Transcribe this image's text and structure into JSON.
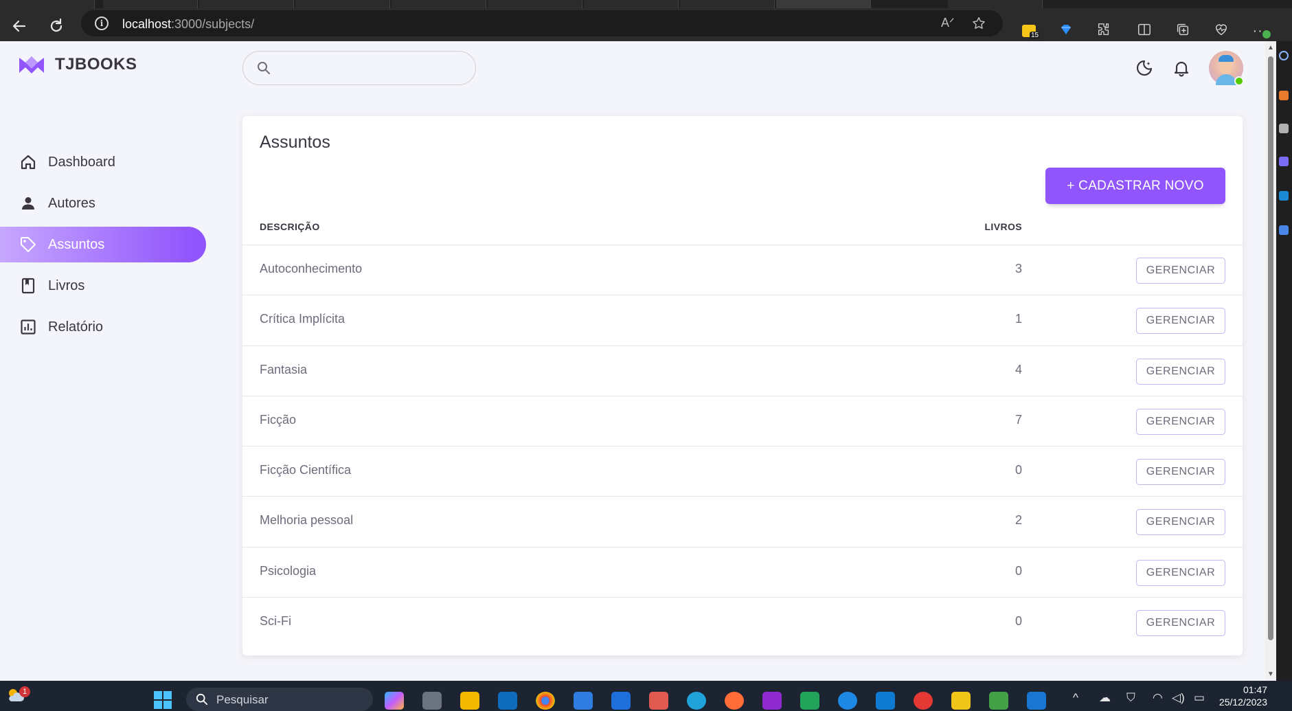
{
  "browser": {
    "address_host": "localhost",
    "address_rest": ":3000/subjects/",
    "read_aloud_label": "A",
    "extensions_badge": "15"
  },
  "app": {
    "brand": "TJBOOKS",
    "search_placeholder": ""
  },
  "sidebar": {
    "items": [
      {
        "label": "Dashboard",
        "icon": "home-icon"
      },
      {
        "label": "Autores",
        "icon": "person-icon"
      },
      {
        "label": "Assuntos",
        "icon": "tag-icon",
        "active": true
      },
      {
        "label": "Livros",
        "icon": "book-icon"
      },
      {
        "label": "Relatório",
        "icon": "chart-icon"
      }
    ]
  },
  "main": {
    "title": "Assuntos",
    "new_button": "+ CADASTRAR NOVO",
    "columns": {
      "description": "DESCRIÇÃO",
      "books": "LIVROS"
    },
    "manage_label": "GERENCIAR",
    "rows": [
      {
        "description": "Autoconhecimento",
        "books": "3"
      },
      {
        "description": "Crítica Implícita",
        "books": "1"
      },
      {
        "description": "Fantasia",
        "books": "4"
      },
      {
        "description": "Ficção",
        "books": "7"
      },
      {
        "description": "Ficção Científica",
        "books": "0"
      },
      {
        "description": "Melhoria pessoal",
        "books": "2"
      },
      {
        "description": "Psicologia",
        "books": "0"
      },
      {
        "description": "Sci-Fi",
        "books": "0"
      }
    ]
  },
  "taskbar": {
    "weather_badge": "1",
    "search_label": "Pesquisar",
    "time": "01:47",
    "date": "25/12/2023"
  },
  "colors": {
    "primary": "#9155fd",
    "text": "#3a3541",
    "muted": "#6e6b7b",
    "background": "#f4f5fa"
  }
}
